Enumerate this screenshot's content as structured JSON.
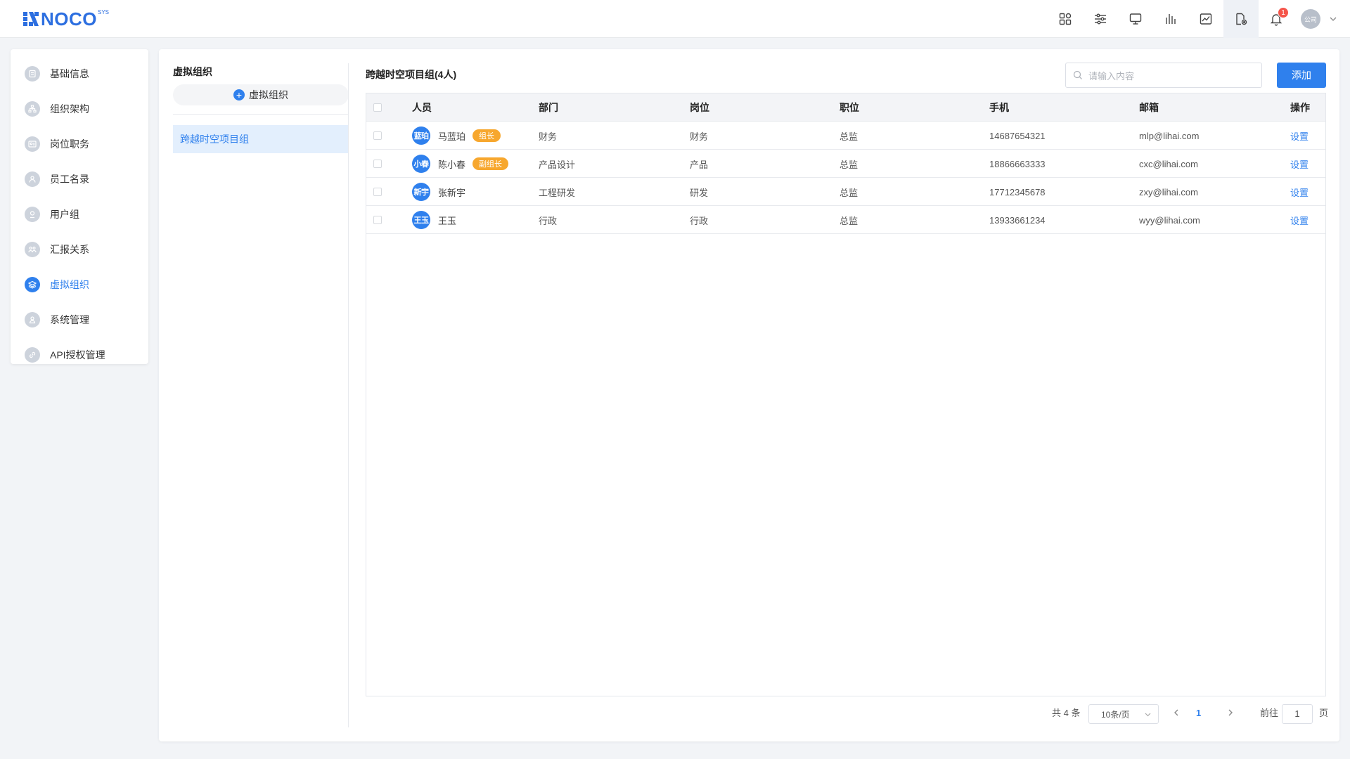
{
  "header": {
    "logo_text": "NOCO",
    "logo_sup": "SYS",
    "notification_count": "1",
    "user_avatar_text": "公司",
    "icons": [
      "apps-icon",
      "sliders-icon",
      "monitor-icon",
      "chart-icon",
      "image-chart-icon",
      "file-settings-icon",
      "bell-icon"
    ]
  },
  "sidebar": {
    "items": [
      {
        "label": "基础信息",
        "icon": "info-icon"
      },
      {
        "label": "组织架构",
        "icon": "org-chart-icon"
      },
      {
        "label": "岗位职务",
        "icon": "id-card-icon"
      },
      {
        "label": "员工名录",
        "icon": "contacts-icon"
      },
      {
        "label": "用户组",
        "icon": "user-group-icon"
      },
      {
        "label": "汇报关系",
        "icon": "report-icon"
      },
      {
        "label": "虚拟组织",
        "icon": "layers-icon",
        "active": true
      },
      {
        "label": "系统管理",
        "icon": "system-icon"
      },
      {
        "label": "API授权管理",
        "icon": "link-icon"
      }
    ]
  },
  "vo_panel": {
    "title": "虚拟组织",
    "add_label": "虚拟组织",
    "groups": [
      "跨越时空项目组"
    ]
  },
  "content": {
    "group_title": "跨越时空项目组(4人)",
    "search_placeholder": "请输入内容",
    "add_button": "添加",
    "columns": [
      "人员",
      "部门",
      "岗位",
      "职位",
      "手机",
      "邮箱",
      "操作"
    ],
    "rows": [
      {
        "avatar": "蓝珀",
        "name": "马蓝珀",
        "badge": "组长",
        "dept": "财务",
        "post": "财务",
        "title": "总监",
        "phone": "14687654321",
        "email": "mlp@lihai.com",
        "op": "设置"
      },
      {
        "avatar": "小春",
        "name": "陈小春",
        "badge": "副组长",
        "dept": "产品设计",
        "post": "产品",
        "title": "总监",
        "phone": "18866663333",
        "email": "cxc@lihai.com",
        "op": "设置"
      },
      {
        "avatar": "新宇",
        "name": "张新宇",
        "badge": "",
        "dept": "工程研发",
        "post": "研发",
        "title": "总监",
        "phone": "17712345678",
        "email": "zxy@lihai.com",
        "op": "设置"
      },
      {
        "avatar": "王玉",
        "name": "王玉",
        "badge": "",
        "dept": "行政",
        "post": "行政",
        "title": "总监",
        "phone": "13933661234",
        "email": "wyy@lihai.com",
        "op": "设置"
      }
    ]
  },
  "pagination": {
    "total": "共 4 条",
    "page_size": "10条/页",
    "current_page": "1",
    "goto_label": "前往",
    "goto_value": "1",
    "page_suffix": "页"
  },
  "colors": {
    "accent": "#2f80ed",
    "badge": "#f7a72e",
    "notification": "#f5554a"
  }
}
